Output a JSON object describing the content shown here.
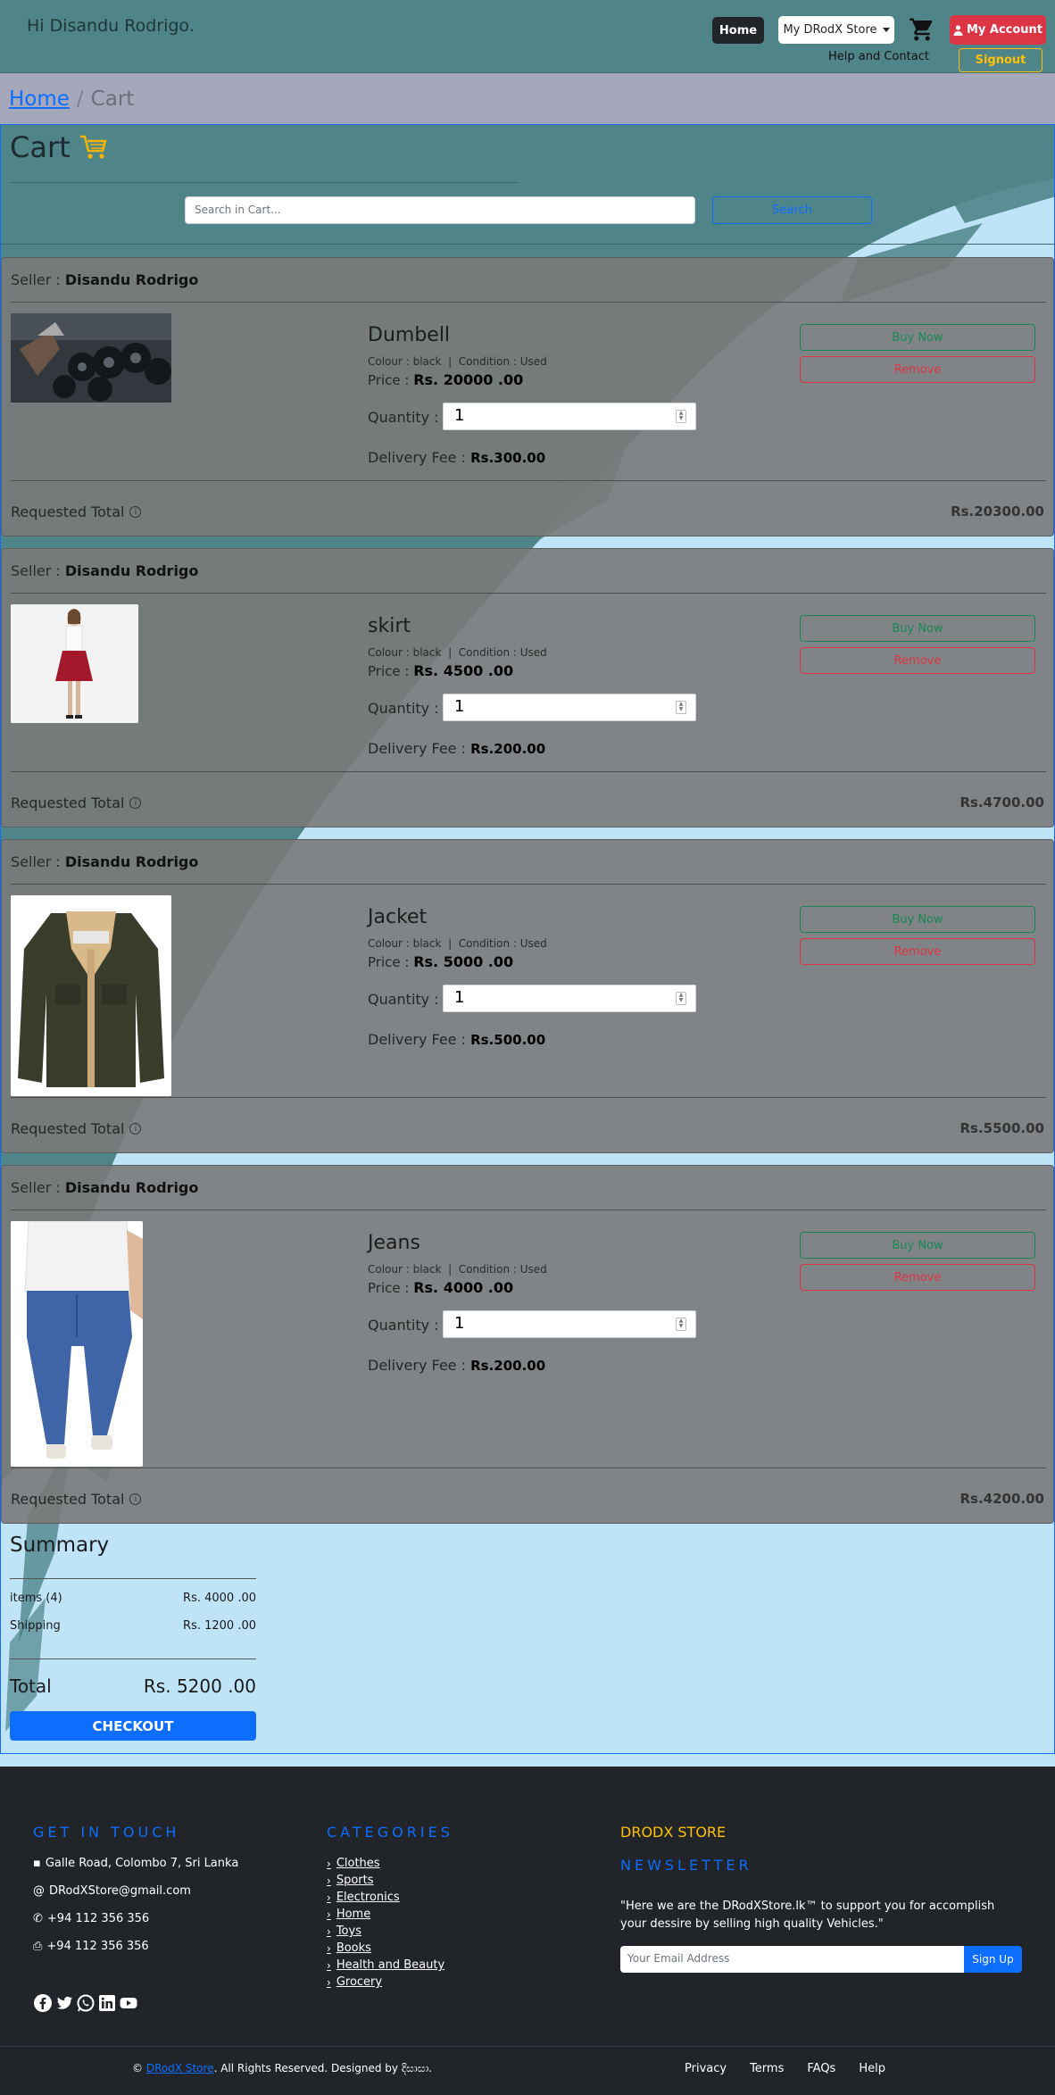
{
  "header": {
    "greeting": "Hi Disandu Rodrigo.",
    "home": "Home",
    "store_menu": "My DRodX Store",
    "account": "My Account",
    "help": "Help and Contact",
    "signout": "Signout"
  },
  "breadcrumb": {
    "home": "Home",
    "separator": "/",
    "current": "Cart"
  },
  "cart": {
    "title": "Cart",
    "search_placeholder": "Search in Cart...",
    "search_button": "Search",
    "seller_label": "Seller :",
    "qty_label": "Quantity :",
    "delivery_label": "Delivery Fee :",
    "price_label": "Price :",
    "buy_label": "Buy Now",
    "remove_label": "Remove",
    "requested_label": "Requested Total",
    "items": [
      {
        "seller": "Disandu Rodrigo",
        "name": "Dumbell",
        "colour": "Colour : black",
        "condition": "Condition : Used",
        "price": "Rs. 20000 .00",
        "quantity": "1",
        "delivery": "Rs.300.00",
        "total": "Rs.20300.00"
      },
      {
        "seller": "Disandu Rodrigo",
        "name": "skirt",
        "colour": "Colour : black",
        "condition": "Condition : Used",
        "price": "Rs. 4500 .00",
        "quantity": "1",
        "delivery": "Rs.200.00",
        "total": "Rs.4700.00"
      },
      {
        "seller": "Disandu Rodrigo",
        "name": "Jacket",
        "colour": "Colour : black",
        "condition": "Condition : Used",
        "price": "Rs. 5000 .00",
        "quantity": "1",
        "delivery": "Rs.500.00",
        "total": "Rs.5500.00"
      },
      {
        "seller": "Disandu Rodrigo",
        "name": "Jeans",
        "colour": "Colour : black",
        "condition": "Condition : Used",
        "price": "Rs. 4000 .00",
        "quantity": "1",
        "delivery": "Rs.200.00",
        "total": "Rs.4200.00"
      }
    ]
  },
  "summary": {
    "title": "Summary",
    "items_label": "items (4)",
    "items_value": "Rs. 4000 .00",
    "shipping_label": "Shipping",
    "shipping_value": "Rs. 1200 .00",
    "total_label": "Total",
    "total_value": "Rs. 5200 .00",
    "checkout": "CHECKOUT"
  },
  "footer": {
    "contact_heading": "GET IN TOUCH",
    "address": "Galle Road, Colombo 7, Sri Lanka",
    "email": "DRodXStore@gmail.com",
    "phone": "+94 112 356 356",
    "fax": "+94 112 356 356",
    "categories_heading": "CATEGORIES",
    "categories": [
      "Clothes",
      "Sports",
      "Electronics",
      "Home",
      "Toys",
      "Books",
      "Health and Beauty",
      "Grocery"
    ],
    "brand": "DRODX STORE",
    "newsletter_heading": "NEWSLETTER",
    "quote": "\"Here we are the DRodXStore.lk™ to support you for accomplish your dessire by selling high quality Vehicles.\"",
    "email_placeholder": "Your Email Address",
    "signup": "Sign Up",
    "copy_prefix": "©",
    "copy_link": "DRodX Store",
    "copy_suffix": ". All Rights Reserved. Designed by දිසාසා.",
    "links": [
      "Privacy",
      "Terms",
      "FAQs",
      "Help"
    ]
  },
  "colors": {
    "header_bg": "#4f8489",
    "accent": "#0d6efd",
    "danger": "#dc3545",
    "success": "#198754",
    "warning": "#ffc107",
    "footer_bg": "#212529"
  }
}
